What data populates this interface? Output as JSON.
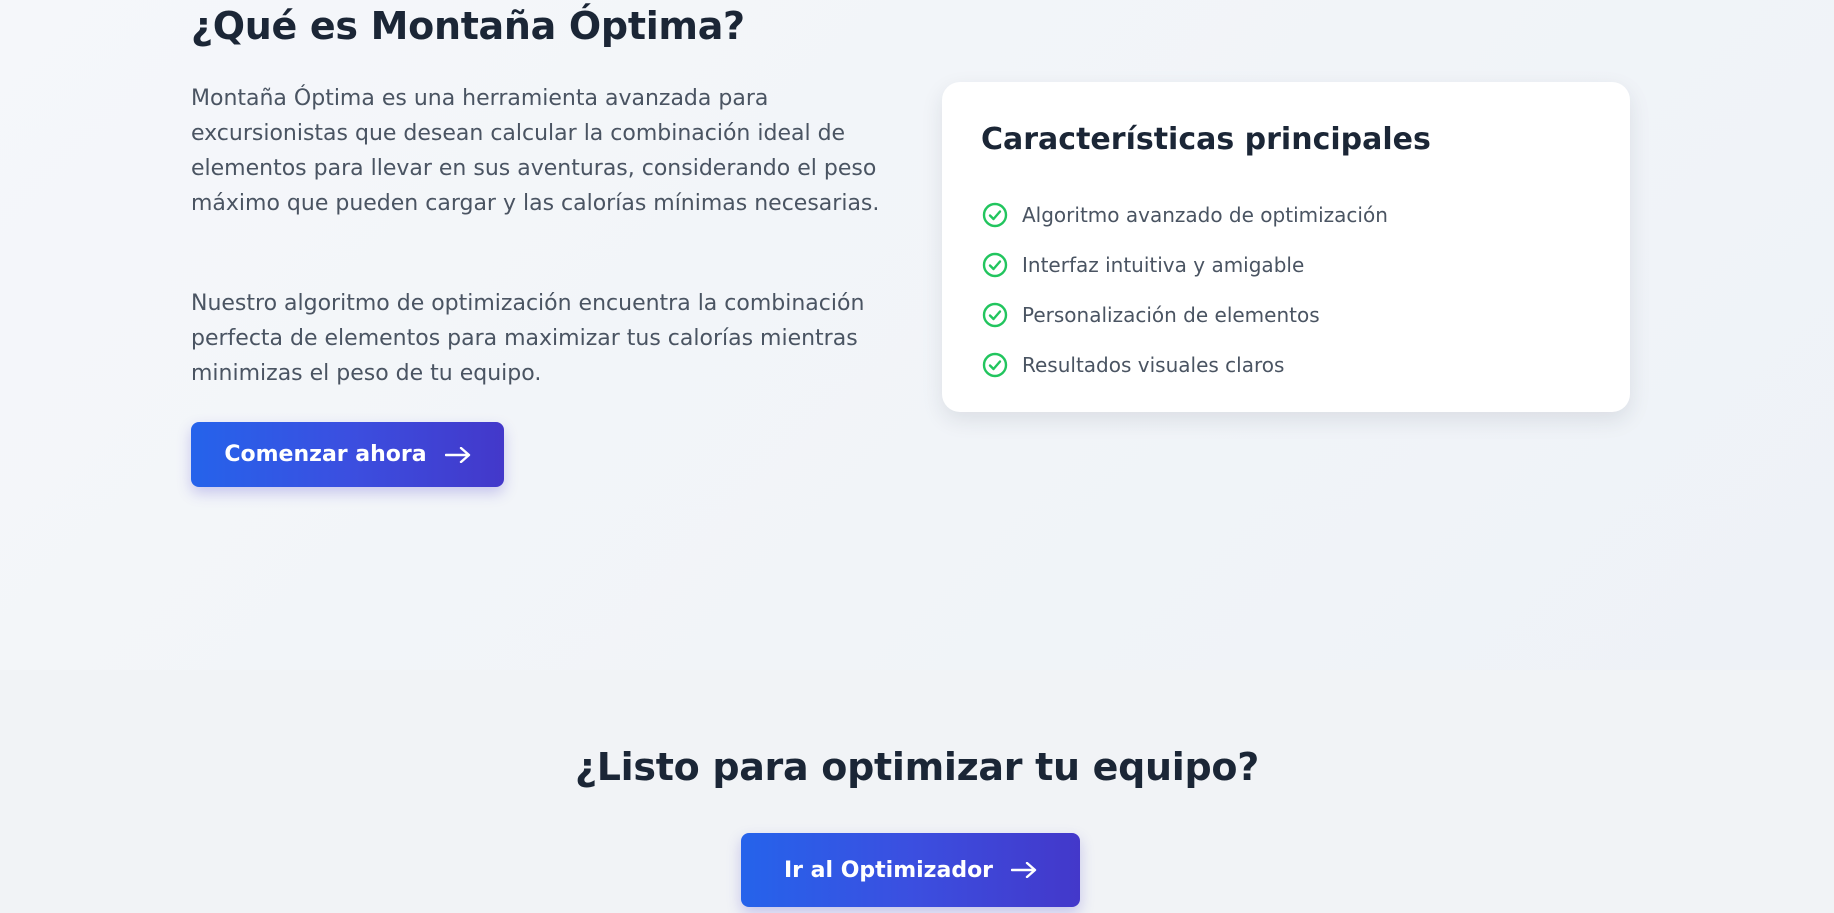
{
  "about": {
    "title": "¿Qué es Montaña Óptima?",
    "paragraph1": "Montaña Óptima es una herramienta avanzada para excursionistas que desean calcular la combinación ideal de elementos para llevar en sus aventuras, considerando el peso máximo que pueden cargar y las calorías mínimas necesarias.",
    "paragraph2": "Nuestro algoritmo de optimización encuentra la combinación perfecta de elementos para maximizar tus calorías mientras minimizas el peso de tu equipo.",
    "start_button": "Comenzar ahora"
  },
  "features_card": {
    "title": "Características principales",
    "items": [
      "Algoritmo avanzado de optimización",
      "Interfaz intuitiva y amigable",
      "Personalización de elementos",
      "Resultados visuales claros"
    ]
  },
  "cta": {
    "title": "¿Listo para optimizar tu equipo?",
    "button": "Ir al Optimizador"
  },
  "colors": {
    "accent_start": "#2563eb",
    "accent_end": "#4338ca",
    "check_green": "#22c55e",
    "heading": "#1b2636",
    "body_text": "#4a5462"
  },
  "icons": {
    "arrow": "arrow-right-icon",
    "check": "check-circle-icon"
  }
}
